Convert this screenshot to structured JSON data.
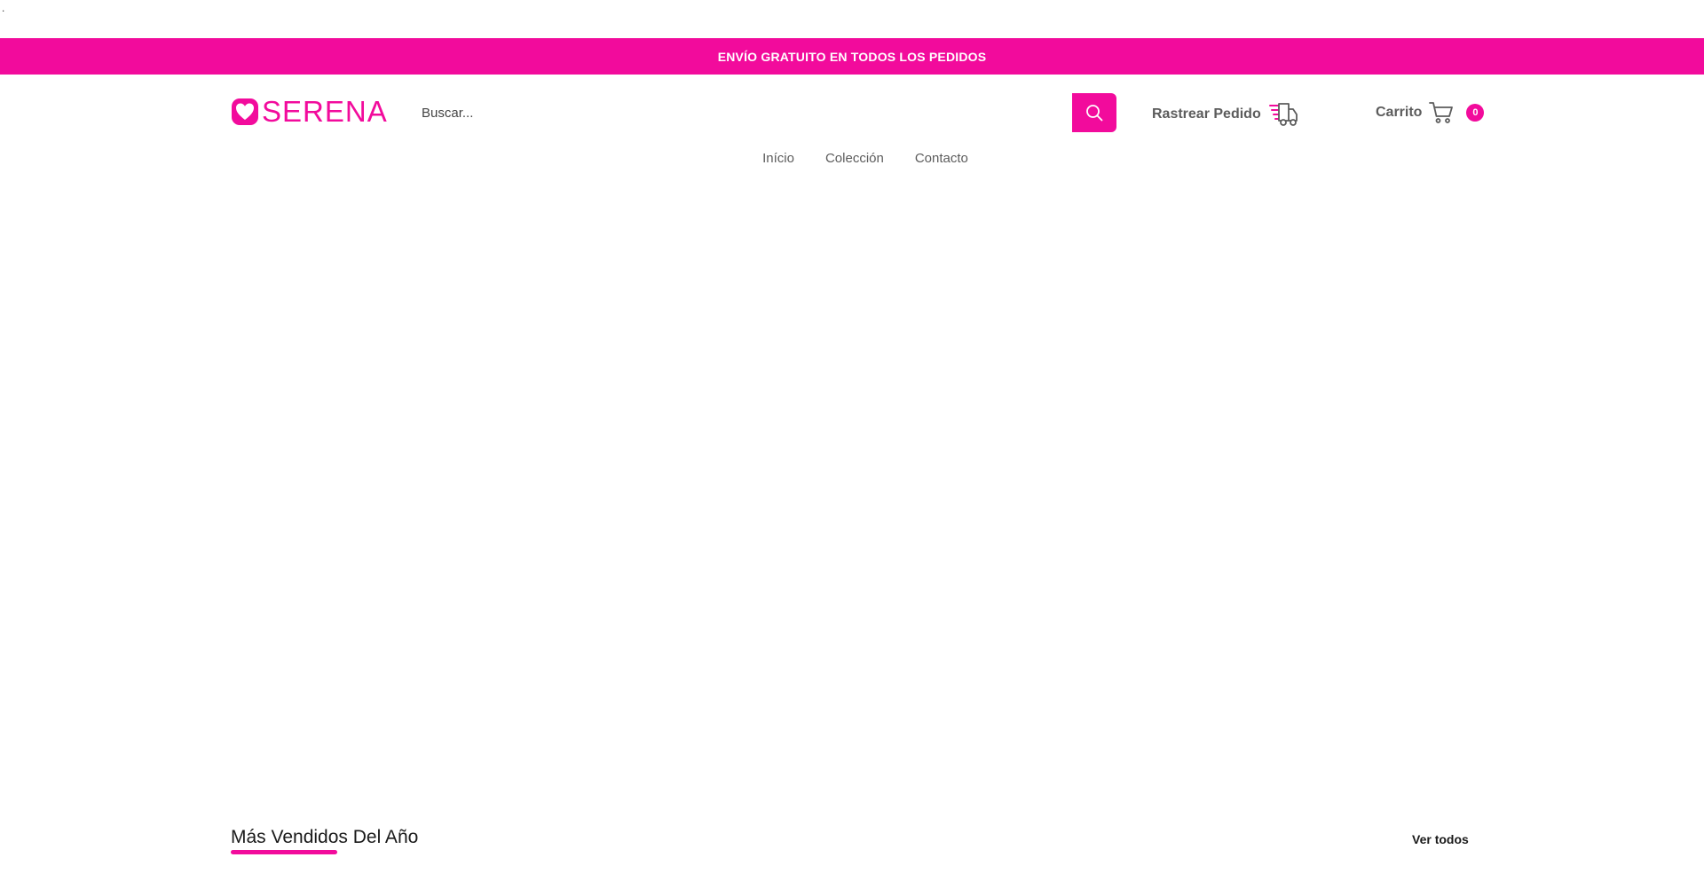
{
  "page": {
    "stray_mark": "."
  },
  "announcement": {
    "text": "ENVÍO GRATUITO EN TODOS LOS PEDIDOS"
  },
  "header": {
    "logo_text": "SERENA",
    "logo_icon": "heart-icon",
    "search": {
      "placeholder": "Buscar...",
      "value": "",
      "button_icon": "search-icon"
    },
    "track_order": {
      "label": "Rastrear Pedido",
      "icon": "delivery-truck-icon"
    },
    "cart": {
      "label": "Carrito",
      "icon": "shopping-cart-icon",
      "count": "0"
    }
  },
  "nav": {
    "items": [
      {
        "label": "Início"
      },
      {
        "label": "Colección"
      },
      {
        "label": "Contacto"
      }
    ]
  },
  "best_sellers": {
    "title": "Más Vendidos Del Año",
    "view_all": "Ver todos"
  },
  "colors": {
    "brand": "#f20b9c",
    "text": "#5c5c5c",
    "heading": "#1a1a1a"
  }
}
